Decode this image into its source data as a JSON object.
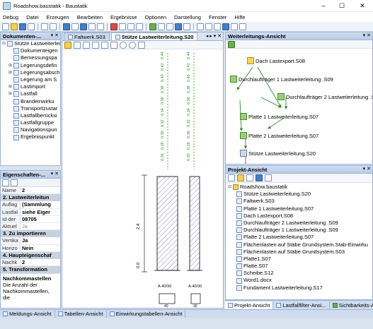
{
  "window": {
    "title": "Roadshow.baustatik - Baustatik",
    "min": "–",
    "max": "☐",
    "close": "✕"
  },
  "menu": [
    "Debug",
    "Datei",
    "Erzeugen",
    "Bearbeiten",
    "Ergebnisse",
    "Optionen",
    "Darstellung",
    "Fenster",
    "Hilfe"
  ],
  "documents_panel": {
    "title": "Dokumenten-...",
    "controls": "▾ ✕",
    "items": [
      {
        "label": "Stütze Lastweiterleitung",
        "level": 0,
        "exp": "⊟"
      },
      {
        "label": "Dokumenteigen",
        "level": 1,
        "exp": ""
      },
      {
        "label": "Bemessungspa",
        "level": 1,
        "exp": ""
      },
      {
        "label": "Legerungsdefin",
        "level": 1,
        "exp": "⊞"
      },
      {
        "label": "Legerungsabschni",
        "level": 1,
        "exp": "⊞"
      },
      {
        "label": "Legerung am S",
        "level": 1,
        "exp": ""
      },
      {
        "label": "Lastimport",
        "level": 1,
        "exp": "⊞"
      },
      {
        "label": "Lastfall",
        "level": 1,
        "exp": "⊞"
      },
      {
        "label": "Brandeinwirku",
        "level": 1,
        "exp": ""
      },
      {
        "label": "Transportzustar",
        "level": 1,
        "exp": ""
      },
      {
        "label": "Lastfallberücksi",
        "level": 1,
        "exp": ""
      },
      {
        "label": "Lastfallgruppe",
        "level": 1,
        "exp": ""
      },
      {
        "label": "Navigationspun",
        "level": 1,
        "exp": ""
      },
      {
        "label": "Ergebnispunkt",
        "level": 1,
        "exp": ""
      }
    ]
  },
  "properties_panel": {
    "title": "Eigenschaften-...",
    "controls": "▾ ✕",
    "rows": [
      {
        "type": "prop",
        "k": "Name",
        "v": "2"
      },
      {
        "type": "cat",
        "label": "2. Lastweiterleitun"
      },
      {
        "type": "prop",
        "k": "Auflag",
        "v": "(Sammlung"
      },
      {
        "type": "prop",
        "k": "Lastfal",
        "v": "siehe Eiger"
      },
      {
        "type": "prop",
        "k": "Id der",
        "v": "08705"
      },
      {
        "type": "prop",
        "k": "Aktuel",
        "v": "Ja",
        "gray": true
      },
      {
        "type": "cat",
        "label": "3. Zu importieren"
      },
      {
        "type": "prop",
        "k": "Vertika",
        "v": "Ja"
      },
      {
        "type": "prop",
        "k": "Horizo",
        "v": "Nein"
      },
      {
        "type": "cat",
        "label": "4. Haupteigenschaf"
      },
      {
        "type": "prop",
        "k": "Nachk",
        "v": "2"
      },
      {
        "type": "cat",
        "label": "5. Transformation"
      }
    ],
    "desc_title": "Nachkommastellen",
    "desc_text": "Die Anzahl der Nachkommastellen, die"
  },
  "doc_tabs": {
    "tab1": "Faltwerk.S03",
    "tab2": "Stütze Lastweiterleitung.S20",
    "controls": "◂ ▸ ▾ ✕"
  },
  "drawing": {
    "col1_labels": [
      "0.44",
      "0.42",
      "0.40",
      "0.38",
      "0.36",
      "0.34",
      "0.32",
      "0.30",
      "0.28",
      "0.26"
    ],
    "col2_labels": [
      "0.44",
      "0.42",
      "0.40",
      "0.38",
      "0.36",
      "0.34",
      "0.32",
      "0.30",
      "0.28",
      "0.26"
    ],
    "dim_top": "2.4",
    "dim_bottom": "0.0",
    "sec1": "A-40/30",
    "sec2": "A-40/30",
    "w1": "40",
    "w2": "30"
  },
  "weiter_panel": {
    "title": "Weiterleitungs-Ansicht",
    "controls": "▾ ✕",
    "nodes": [
      {
        "label": "Dach Lastexport.S08"
      },
      {
        "label": "Durchlaufträger 1 Lastweiterleitung .S09"
      },
      {
        "label": "Durchlaufträger 2 Lastweiterleitung .S09"
      },
      {
        "label": "Platte 1 Lastweiterleitung.S07"
      },
      {
        "label": "Platte 2 Lastweiterleitung.S07"
      },
      {
        "label": "Stütze Lastweiterleitung.S20"
      }
    ]
  },
  "projekt_panel": {
    "title": "Projekt-Ansicht",
    "controls": "▾ ✕",
    "root": "Roadshow.baustatik",
    "items": [
      "Stütze Lastweiterleitung.S20",
      "Faltwerk.S03",
      "Platte 1 Lastweiterleitung.S07",
      "Dach Lastexport.S08",
      "Durchlaufträger 2 Lastweiterleitung .S09",
      "Durchlaufträger 1 Lastweiterleitung .S09",
      "Platte 2 Lastweiterleitung.S07",
      "Flächenlasten auf Stäbe Grundsystem.Stab-Einwirku",
      "Flächenlasten auf Stäbe Grundsystem.S03",
      "Platte1.S07",
      "Platte.S07",
      "Scheibe.S12",
      "Word1.docx",
      "Fundament Lastweiterleitung.S17"
    ]
  },
  "right_tabs": [
    "Projekt-Ansicht",
    "Lastfallfilter-Ansi...",
    "Sichtbarkeits-Ansi..."
  ],
  "bottom_tabs": [
    "Meldungs-Ansicht",
    "Tabellen-Ansicht",
    "Einwirkungstabellen-Ansicht"
  ]
}
